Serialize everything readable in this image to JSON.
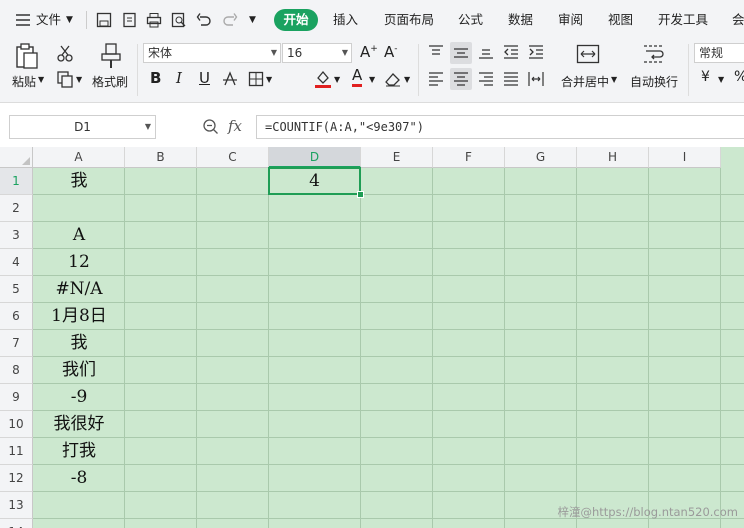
{
  "menu": {
    "file_label": "文件",
    "tabs": [
      "开始",
      "插入",
      "页面布局",
      "公式",
      "数据",
      "审阅",
      "视图",
      "开发工具",
      "会"
    ],
    "active_tab": "开始"
  },
  "ribbon": {
    "paste_label": "粘贴",
    "format_painter_label": "格式刷",
    "font_name": "宋体",
    "font_size": "16",
    "bold_glyph": "B",
    "italic_glyph": "I",
    "underline_glyph": "U",
    "font_color_glyph": "A",
    "merge_center_label": "合并居中",
    "wrap_text_label": "自动换行",
    "number_format": "常规",
    "currency_glyph": "¥",
    "percent_glyph": "%"
  },
  "formula_bar": {
    "name_box": "D1",
    "fx_label": "fx",
    "formula": "=COUNTIF(A:A,\"<9e307\")"
  },
  "sheet": {
    "columns": [
      "A",
      "B",
      "C",
      "D",
      "E",
      "F",
      "G",
      "H",
      "I"
    ],
    "rows": [
      "1",
      "2",
      "3",
      "4",
      "5",
      "6",
      "7",
      "8",
      "9",
      "10",
      "11",
      "12",
      "13",
      "14"
    ],
    "column_a": [
      "我",
      "",
      "A",
      "12",
      "#N/A",
      "1月8日",
      "我",
      "我们",
      "-9",
      "我很好",
      "打我",
      "-8",
      "",
      ""
    ],
    "selected_cell": "D1",
    "selected_value": "4"
  },
  "watermark": "梓潼@https://blog.ntan520.com",
  "colors": {
    "accent": "#1aa260",
    "sheet_bg": "#cce8cf",
    "gridline": "#a9c9ac"
  }
}
